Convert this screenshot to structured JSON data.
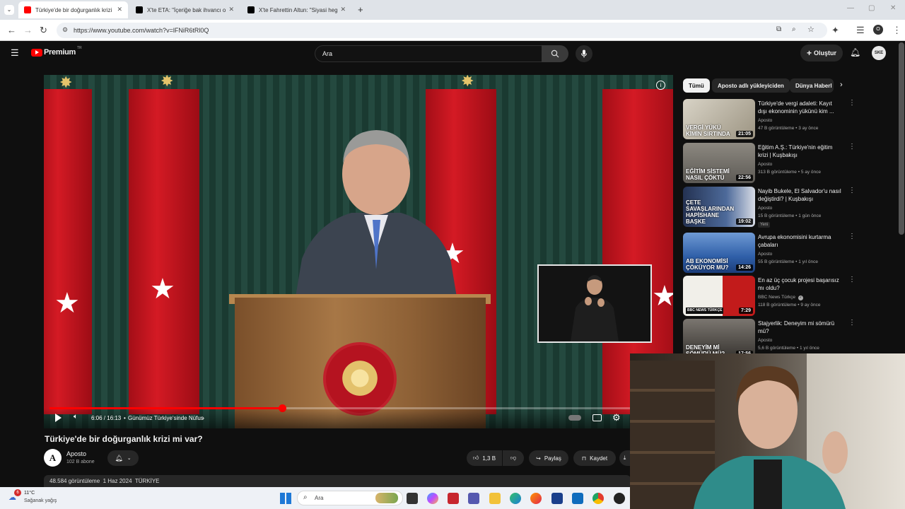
{
  "browser": {
    "tabs": [
      {
        "label": "Türkiye'de bir doğurganlık krizi",
        "favicon_color": "#ff0000"
      },
      {
        "label": "X'te ETA: \"İçeriğe bak ihvancı o",
        "favicon_color": "#000000"
      },
      {
        "label": "X'te Fahrettin Altun: \"Siyasi heg",
        "favicon_color": "#000000"
      }
    ],
    "url": "https://www.youtube.com/watch?v=lFNiR6tRl0Q"
  },
  "header": {
    "logo_text": "Premium",
    "logo_badge": "TR",
    "search_placeholder": "Ara",
    "create_label": "Oluştur",
    "avatar_text": "SKE"
  },
  "player": {
    "time": "6:06 / 16:13",
    "chapter": "Günümüz Türkiye'sinde Nüfus",
    "progress_fraction": 0.376
  },
  "video": {
    "title": "Türkiye'de bir doğurganlık krizi mi var?",
    "channel_initial": "A",
    "channel_name": "Aposto",
    "subscribers": "102 B abone",
    "likes": "1,3 B",
    "share_label": "Paylaş",
    "save_label": "Kaydet",
    "description_line": "48.584 görüntüleme  1 Haz 2024  TÜRKİYE"
  },
  "sidebar": {
    "chips": [
      "Tümü",
      "Aposto adlı yükleyiciden",
      "Dünya Haberl"
    ],
    "items": [
      {
        "title": "Türkiye'de vergi adaleti: Kayıt dışı ekonominin yükünü kim ...",
        "channel": "Aposto",
        "meta": "47 B görüntüleme • 3 ay önce",
        "duration": "21:05",
        "thumb_text": "VERGİ YÜKÜ KİMİN SIRTINDA",
        "thumb_color": "#c8c4b8"
      },
      {
        "title": "Eğitim A.Ş.: Türkiye'nin eğitim krizi | Kuşbakışı",
        "channel": "Aposto",
        "meta": "313 B görüntüleme • 5 ay önce",
        "duration": "22:56",
        "thumb_text": "EĞİTİM SİSTEMİ NASIL ÇÖKTÜ",
        "thumb_color": "#7d7a74"
      },
      {
        "title": "Nayib Bukele, El Salvador'u nasıl değiştirdi? | Kuşbakışı",
        "channel": "Aposto",
        "meta": "15 B görüntüleme • 1 gün önce",
        "badge": "Yeni",
        "duration": "19:02",
        "thumb_text": "ÇETE SAVAŞLARINDAN HAPİSHANE BAŞKE",
        "thumb_color": "#3b4a6b"
      },
      {
        "title": "Avrupa ekonomisini kurtarma çabaları",
        "channel": "Aposto",
        "meta": "55 B görüntüleme • 1 yıl önce",
        "duration": "14:26",
        "thumb_text": "AB EKONOMİSİ ÇÖKÜYOR MU?",
        "thumb_color": "#2f5fa8"
      },
      {
        "title": "En az üç çocuk projesi başarısız mı oldu?",
        "channel": "BBC News Türkçe",
        "meta": "118 B görüntüleme • 9 ay önce",
        "duration": "7:29",
        "thumb_text": "BBC NEWS TÜRKÇE",
        "thumb_color": "#c21b1b"
      },
      {
        "title": "Stajyerlik: Deneyim mi sömürü mü?",
        "channel": "Aposto",
        "meta": "5,6 B görüntüleme • 1 yıl önce",
        "duration": "17:56",
        "thumb_text": "DENEYİM Mİ SÖMÜRÜ MÜ?",
        "thumb_color": "#4a4a4a"
      }
    ]
  },
  "taskbar": {
    "weather_temp": "11°C",
    "weather_desc": "Sağanak yağış",
    "notification_count": "6",
    "search_placeholder": "Ara"
  },
  "colors": {
    "youtube_red": "#ff0000",
    "background": "#0f0f0f",
    "flag_red": "#d41a24"
  }
}
